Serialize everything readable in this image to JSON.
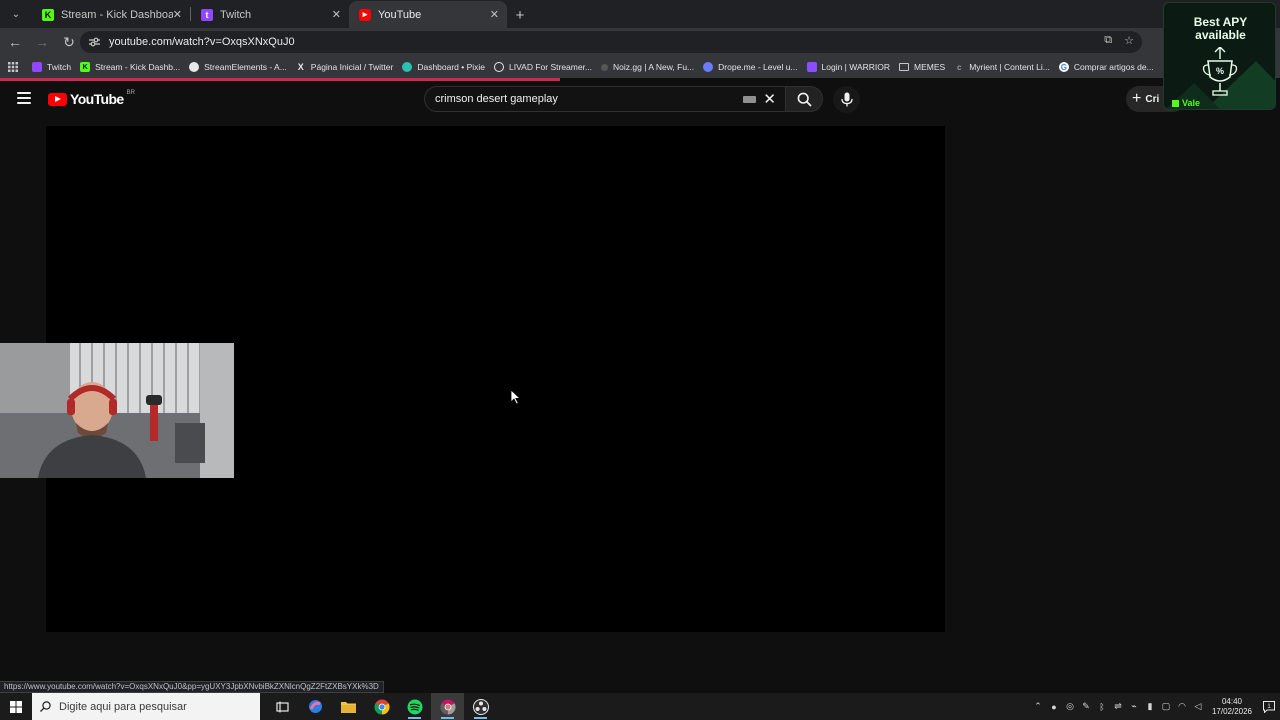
{
  "browser": {
    "tabs": [
      {
        "title": "Stream - Kick Dashboard",
        "favicon": "kick-icon",
        "color": "#53fc18",
        "active": false
      },
      {
        "title": "Twitch",
        "favicon": "twitch-icon",
        "color": "#9146ff",
        "active": false
      },
      {
        "title": "YouTube",
        "favicon": "youtube-icon",
        "color": "#ff0000",
        "active": true
      }
    ],
    "address": "youtube.com/watch?v=OxqsXNxQuJ0",
    "bookmarks": [
      {
        "label": "Twitch",
        "icon": "twitch-icon",
        "color": "#9146ff"
      },
      {
        "label": "Stream - Kick Dashb...",
        "icon": "kick-icon",
        "color": "#53fc18"
      },
      {
        "label": "StreamElements - A...",
        "icon": "streamelements-icon",
        "color": "#e8e8e8"
      },
      {
        "label": "Página Inicial / Twitter",
        "icon": "x-icon",
        "color": "#e8e8e8"
      },
      {
        "label": "Dashboard • Pixie",
        "icon": "pixie-icon",
        "color": "#2bc0b4"
      },
      {
        "label": "LIVAD For Streamer...",
        "icon": "livad-icon",
        "color": "#e8e8e8"
      },
      {
        "label": "Noiz.gg | A New, Fu...",
        "icon": "noiz-icon",
        "color": "#555555"
      },
      {
        "label": "Drope.me - Level u...",
        "icon": "drope-icon",
        "color": "#6a7cff"
      },
      {
        "label": "Login | WARRIOR",
        "icon": "warrior-icon",
        "color": "#8a4dff"
      },
      {
        "label": "MEMES",
        "icon": "folder-icon",
        "color": "#c4c7c5"
      },
      {
        "label": "Myrient | Content Li...",
        "icon": "myrient-icon",
        "color": "#777777"
      },
      {
        "label": "Comprar artigos de...",
        "icon": "google-icon",
        "color": "#4285f4"
      }
    ]
  },
  "youtube": {
    "logo_text": "YouTube",
    "country": "BR",
    "search_value": "crimson desert gameplay",
    "create_label": "Cri"
  },
  "ad": {
    "title_line1": "Best APY",
    "title_line2": "available",
    "cta": "Vale"
  },
  "status_url": "https://www.youtube.com/watch?v=OxqsXNxQuJ0&pp=ygUXY3JpbXNvbiBkZXNlcnQgZ2FtZXBsYXk%3D",
  "taskbar": {
    "search_placeholder": "Digite aqui para pesquisar",
    "time": "04:40",
    "date": "17/02/2026"
  }
}
